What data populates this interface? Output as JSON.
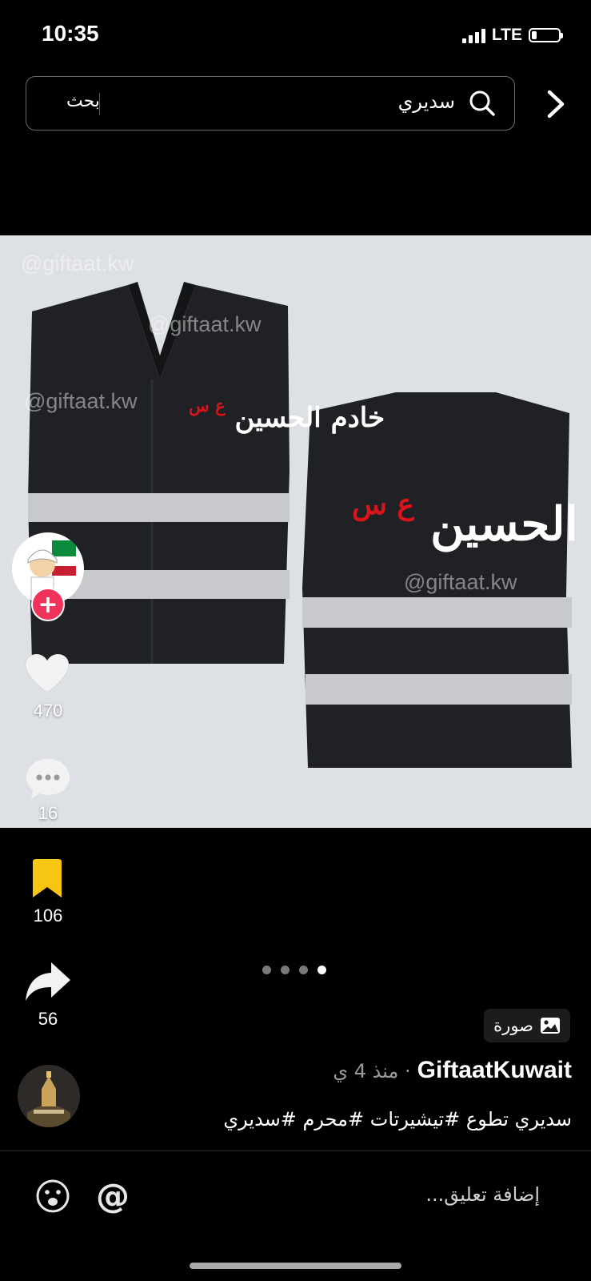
{
  "status_bar": {
    "time": "10:35",
    "network": "LTE",
    "battery_level": 0.2
  },
  "search": {
    "query": "سديري",
    "button_label": "بحث"
  },
  "post_image": {
    "watermark": "@giftaat.kw",
    "vest_text": "خادم الحسين",
    "vest_text_suffix": "ع س"
  },
  "actions": {
    "likes": "470",
    "comments": "16",
    "saves": "106",
    "shares": "56"
  },
  "carousel": {
    "total": 4,
    "active_index": 3
  },
  "media_badge": {
    "label": "صورة"
  },
  "author": {
    "name": "GiftaatKuwait",
    "time_ago": "· منذ 4 ي"
  },
  "caption": "سديري تطوع  #تيشيرتات #محرم #سديري",
  "comment_bar": {
    "placeholder": "إضافة تعليق..."
  },
  "colors": {
    "accent": "#f0335a",
    "save_yellow": "#f6c613",
    "vest_red": "#d9141b"
  }
}
